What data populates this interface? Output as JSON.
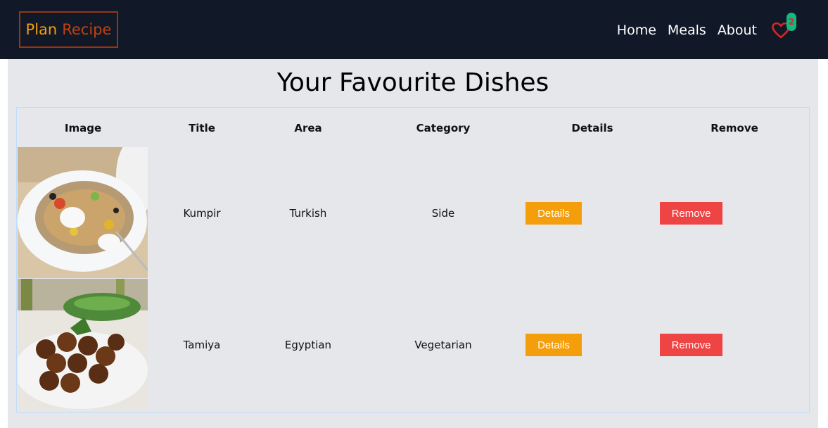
{
  "brand": {
    "part1": "Plan",
    "part2": "Recipe"
  },
  "nav": {
    "home": "Home",
    "meals": "Meals",
    "about": "About"
  },
  "favorites": {
    "count": "2",
    "icon": "heart-icon"
  },
  "page": {
    "title": "Your Favourite Dishes"
  },
  "table": {
    "headers": [
      "Image",
      "Title",
      "Area",
      "Category",
      "Details",
      "Remove"
    ],
    "rows": [
      {
        "title": "Kumpir",
        "area": "Turkish",
        "category": "Side",
        "details_label": "Details",
        "remove_label": "Remove"
      },
      {
        "title": "Tamiya",
        "area": "Egyptian",
        "category": "Vegetarian",
        "details_label": "Details",
        "remove_label": "Remove"
      }
    ]
  },
  "colors": {
    "navbar": "#111827",
    "brand_plan": "#f59e0b",
    "brand_recipe": "#c2410c",
    "details_button": "#f59e0b",
    "remove_button": "#ef4444",
    "badge": "#10b981",
    "background": "#e5e7eb"
  }
}
